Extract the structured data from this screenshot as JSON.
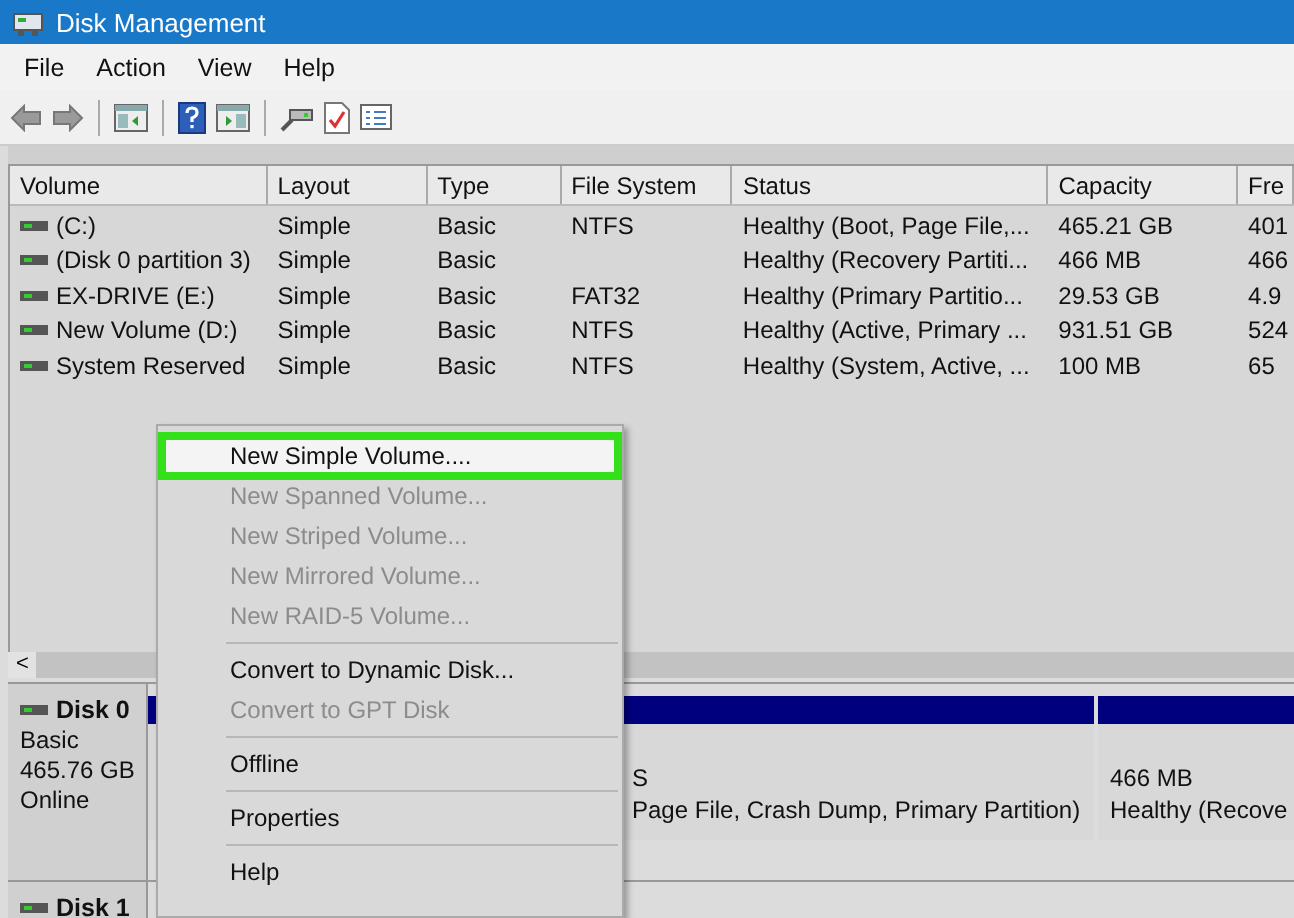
{
  "window": {
    "title": "Disk Management"
  },
  "menu_bar": [
    "File",
    "Action",
    "View",
    "Help"
  ],
  "table": {
    "columns": [
      "Volume",
      "Layout",
      "Type",
      "File System",
      "Status",
      "Capacity",
      "Fre"
    ],
    "rows": [
      [
        "(C:)",
        "Simple",
        "Basic",
        "NTFS",
        "Healthy (Boot, Page File,...",
        "465.21 GB",
        "401"
      ],
      [
        "(Disk 0 partition 3)",
        "Simple",
        "Basic",
        "",
        "Healthy (Recovery Partiti...",
        "466 MB",
        "466"
      ],
      [
        "EX-DRIVE (E:)",
        "Simple",
        "Basic",
        "FAT32",
        "Healthy (Primary Partitio...",
        "29.53 GB",
        "4.9"
      ],
      [
        "New Volume (D:)",
        "Simple",
        "Basic",
        "NTFS",
        "Healthy (Active, Primary ...",
        "931.51 GB",
        "524"
      ],
      [
        "System Reserved",
        "Simple",
        "Basic",
        "NTFS",
        "Healthy (System, Active, ...",
        "100 MB",
        "65"
      ]
    ],
    "scroll_left": "<"
  },
  "disks": [
    {
      "name": "Disk 0",
      "lines": [
        "Basic",
        "465.76 GB",
        "Online"
      ],
      "partitions": [
        {
          "name": "S",
          "status": "Page File, Crash Dump, Primary Partition)"
        },
        {
          "name": "466 MB",
          "status": "Healthy (Recove"
        }
      ]
    },
    {
      "name": "Disk 1"
    }
  ],
  "context_menu": [
    {
      "kind": "item",
      "label": "New Simple Volume....",
      "disabled": false,
      "selected": true
    },
    {
      "kind": "item",
      "label": "New Spanned Volume...",
      "disabled": true,
      "selected": false
    },
    {
      "kind": "item",
      "label": "New Striped Volume...",
      "disabled": true,
      "selected": false
    },
    {
      "kind": "item",
      "label": "New Mirrored Volume...",
      "disabled": true,
      "selected": false
    },
    {
      "kind": "item",
      "label": "New RAID-5 Volume...",
      "disabled": true,
      "selected": false
    },
    {
      "kind": "separator"
    },
    {
      "kind": "item",
      "label": "Convert to Dynamic Disk...",
      "disabled": false,
      "selected": false
    },
    {
      "kind": "item",
      "label": "Convert to GPT Disk",
      "disabled": true,
      "selected": false
    },
    {
      "kind": "separator"
    },
    {
      "kind": "item",
      "label": "Offline",
      "disabled": false,
      "selected": false
    },
    {
      "kind": "separator"
    },
    {
      "kind": "item",
      "label": "Properties",
      "disabled": false,
      "selected": false
    },
    {
      "kind": "separator"
    },
    {
      "kind": "item",
      "label": "Help",
      "disabled": false,
      "selected": false
    }
  ]
}
